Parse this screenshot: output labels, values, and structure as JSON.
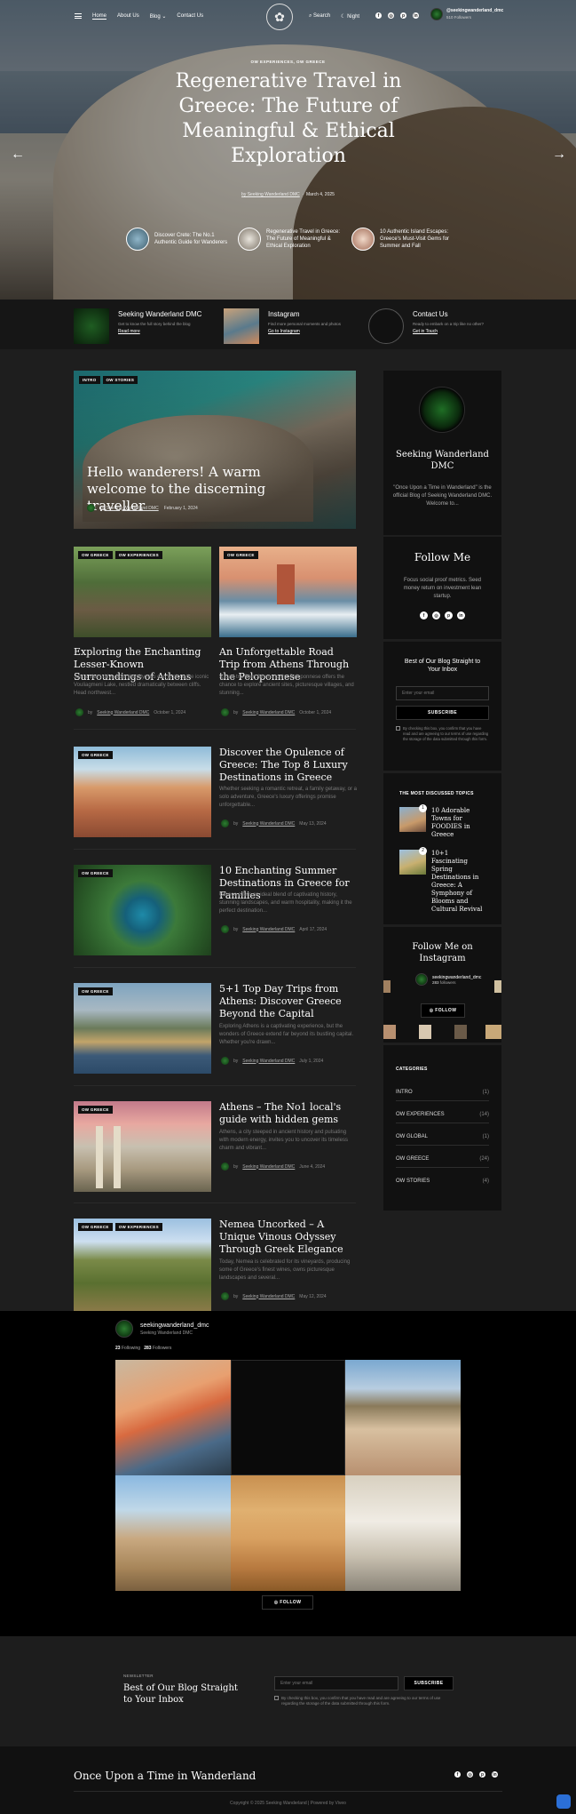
{
  "header": {
    "nav": [
      "Home",
      "About Us",
      "Blog",
      "Contact Us"
    ],
    "search_label": "Search",
    "night_label": "Night",
    "profile_name": "@seekingwanderland_dmc",
    "profile_sub": "510 Followers"
  },
  "hero": {
    "categories": "OW EXPERIENCES, OW GREECE",
    "title": "Regenerative Travel in Greece: The Future of Meaningful & Ethical Exploration",
    "author": "by Seeking Wanderland DMC",
    "date": "March 4, 2025",
    "related": [
      "Discover Crete: The No.1 Authentic Guide for Wanderers",
      "Regenerative Travel in Greece: The Future of Meaningful & Ethical Exploration",
      "10 Authentic Island Escapes: Greece's Must-Visit Gems for Summer and Fall"
    ]
  },
  "features": [
    {
      "title": "Seeking Wanderland DMC",
      "desc": "Get to know the full story behind the blog",
      "link": "Read more"
    },
    {
      "title": "Instagram",
      "desc": "Find more personal moments and photos",
      "link": "Go to Instagram"
    },
    {
      "title": "Contact Us",
      "desc": "Ready to embark on a trip like no other?",
      "link": "Get in Touch"
    }
  ],
  "featured": {
    "badges": [
      "INTRO",
      "OW STORIES"
    ],
    "title": "Hello wanderers! A warm welcome to the discerning traveller",
    "author": "by Seeking Wanderland DMC",
    "date": "February 1, 2024"
  },
  "grid_posts": [
    {
      "badges": [
        "OW GREECE",
        "OW EXPERIENCES"
      ],
      "title": "Exploring the Enchanting Lesser-Known Surroundings of Athens",
      "excerpt": "Just a short drive from the city, you can explore the iconic Vouliagmeni Lake, nestled dramatically between cliffs. Head northwest...",
      "author": "Seeking Wanderland DMC",
      "date": "October 1, 2024"
    },
    {
      "badges": [
        "OW GREECE"
      ],
      "title": "An Unforgettable Road Trip from Athens Through the Peloponnese",
      "excerpt": "A road trip from Athens to the Peloponnese offers the chance to explore ancient sites, picturesque villages, and stunning...",
      "author": "Seeking Wanderland DMC",
      "date": "October 1, 2024"
    }
  ],
  "list_posts": [
    {
      "badge": "OW GREECE",
      "title": "Discover the Opulence of Greece: The Top 8 Luxury Destinations in Greece",
      "excerpt": "Whether seeking a romantic retreat, a family getaway, or a solo adventure, Greece's luxury offerings promise unforgettable...",
      "author": "Seeking Wanderland DMC",
      "date": "May 13, 2024"
    },
    {
      "badge": "OW GREECE",
      "title": "10 Enchanting Summer Destinations in Greece for Families",
      "excerpt": "Greece offers an ideal blend of captivating history, stunning landscapes, and warm hospitality, making it the perfect destination...",
      "author": "Seeking Wanderland DMC",
      "date": "April 17, 2024"
    },
    {
      "badge": "OW GREECE",
      "title": "5+1 Top Day Trips from Athens: Discover Greece Beyond the Capital",
      "excerpt": "Exploring Athens is a captivating experience, but the wonders of Greece extend far beyond its bustling capital. Whether you're drawn...",
      "author": "Seeking Wanderland DMC",
      "date": "July 1, 2024"
    },
    {
      "badge": "OW GREECE",
      "title": "Athens – The No1 local's guide with hidden gems",
      "excerpt": "Athens, a city steeped in ancient history and pulsating with modern energy, invites you to uncover its timeless charm and vibrant...",
      "author": "Seeking Wanderland DMC",
      "date": "June 4, 2024"
    },
    {
      "badge": "OW GREECE",
      "badge2": "OW EXPERIENCES",
      "title": "Nemea Uncorked – A Unique Vinous Odyssey Through Greek Elegance",
      "excerpt": "Today, Nemea is celebrated for its vineyards, producing some of Greece's finest wines, owns picturesque landscapes and several...",
      "author": "Seeking Wanderland DMC",
      "date": "May 12, 2024"
    }
  ],
  "sidebar": {
    "about_title": "Seeking Wanderland DMC",
    "about_text": "\"Once Upon a Time in Wanderland\" is the official Blog of Seeking Wanderland DMC. Welcome to...",
    "follow_title": "Follow Me",
    "follow_text": "Focus social proof metrics. Seed money return on investment lean startup.",
    "newsletter_title": "Best of Our Blog Straight to Your Inbox",
    "email_placeholder": "Enter your email",
    "subscribe": "SUBSCRIBE",
    "consent": "By checking this box, you confirm that you have read and are agreeing to our terms of use regarding the storage of the data submitted through this form.",
    "discussed_title": "THE MOST DISCUSSED TOPICS",
    "discussed": [
      {
        "num": "1",
        "title": "10 Adorable Towns for FOODIES in Greece"
      },
      {
        "num": "2",
        "title": "10+1 Fascinating Spring Destinations in Greece: A Symphony of Blooms and Cultural Revival"
      }
    ],
    "insta_title": "Follow Me on Instagram",
    "insta_handle": "seekingwanderland_dmc",
    "insta_count": "283",
    "insta_count_label": "followers",
    "insta_follow": "FOLLOW",
    "categories_title": "CATEGORIES",
    "categories": [
      {
        "name": "INTRO",
        "count": "(1)"
      },
      {
        "name": "OW EXPERIENCES",
        "count": "(14)"
      },
      {
        "name": "OW GLOBAL",
        "count": "(1)"
      },
      {
        "name": "OW GREECE",
        "count": "(24)"
      },
      {
        "name": "OW STORIES",
        "count": "(4)"
      }
    ]
  },
  "insta_section": {
    "handle": "seekingwanderland_dmc",
    "name": "Seeking Wanderland DMC",
    "following": "23",
    "following_label": "Following",
    "followers": "283",
    "followers_label": "Followers",
    "follow": "FOLLOW"
  },
  "newsletter": {
    "label": "NEWSLETTER",
    "title": "Best of Our Blog Straight to Your Inbox",
    "placeholder": "Enter your email",
    "button": "SUBSCRIBE",
    "consent": "By checking this box, you confirm that you have read and are agreeing to our terms of use regarding the storage of the data submitted through this form."
  },
  "footer": {
    "title": "Once Upon a Time in Wanderland",
    "copyright": "Copyright © 2025 Seeking Wanderland | Powered by Viveo"
  }
}
